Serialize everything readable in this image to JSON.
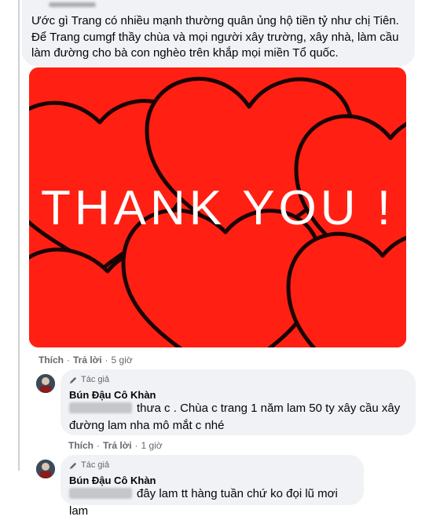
{
  "top_comment": {
    "text": "Ước gì Trang có nhiều mạnh thường quân ủng hộ tiền tỷ như chị Tiên. Để Trang cumgf thầy chùa và mọi người xây trường, xây nhà, làm cầu làm đường cho bà con nghèo trên khắp mọi miền Tổ quốc.",
    "image_text": "THANK YOU !",
    "actions": {
      "like": "Thích",
      "reply": "Trả lời",
      "time": "5 giờ"
    }
  },
  "replies": [
    {
      "badge": "Tác giả",
      "author": "Bún Đậu Cô Khàn",
      "text": "thưa c . Chùa c trang 1 năm lam 50 ty xây cầu xây đường lam nha mô mắt c nhé",
      "actions": {
        "like": "Thích",
        "reply": "Trả lời",
        "time": "1 giờ"
      }
    },
    {
      "badge": "Tác giả",
      "author": "Bún Đậu Cô Khàn",
      "text": "đây lam tt hàng tuần chứ ko đọi lũ mơi lam"
    }
  ],
  "colors": {
    "image_bg": "#ff2013",
    "bubble": "#f0f2f5",
    "meta": "#65676b"
  }
}
